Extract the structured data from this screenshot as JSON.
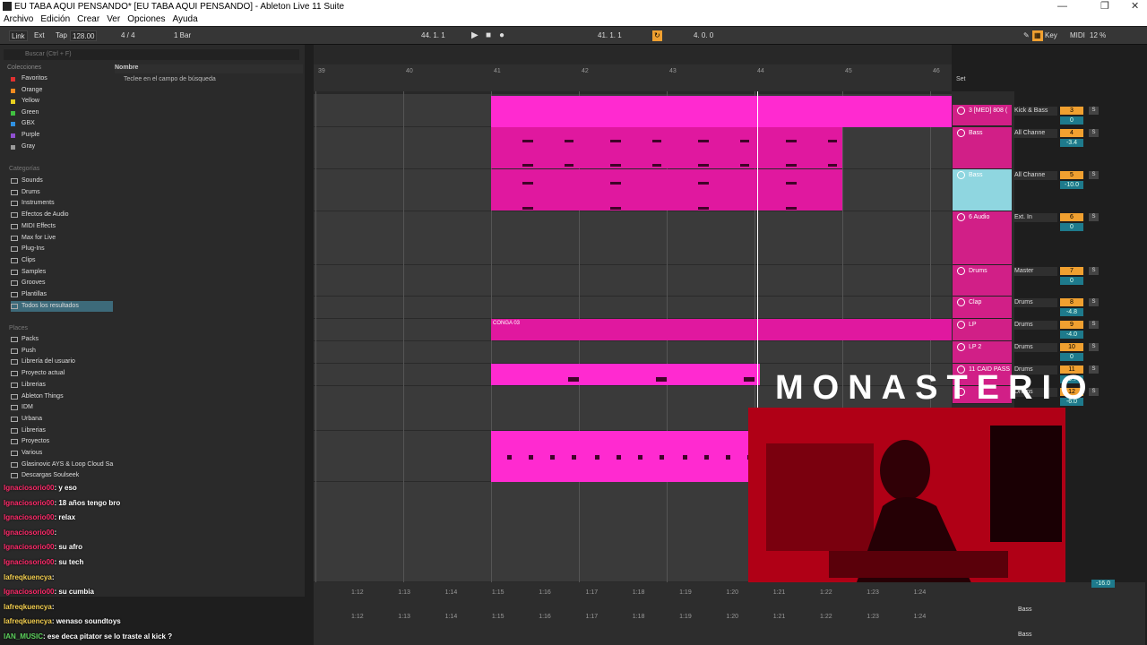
{
  "window": {
    "title": "EU TABA AQUI PENSANDO*  [EU TABA AQUI PENSANDO] - Ableton Live 11 Suite"
  },
  "menu": [
    "Archivo",
    "Edición",
    "Crear",
    "Ver",
    "Opciones",
    "Ayuda"
  ],
  "control": {
    "link": "Link",
    "ext": "Ext",
    "tap": "Tap",
    "tempo": "128.00",
    "meter": "4 / 4",
    "quant": "1 Bar",
    "pos": "44.   1.   1",
    "loop_start": "41.   1.   1",
    "loop_len": "4.   0.   0",
    "key": "Key",
    "midi": "MIDI",
    "cpu": "12 %"
  },
  "browser": {
    "search_placeholder": "Buscar (Ctrl + F)",
    "collections_label": "Colecciones",
    "name_header": "Nombre",
    "hint": "Teclee en el campo de búsqueda",
    "collections": [
      {
        "label": "Favoritos",
        "color": "#e03030"
      },
      {
        "label": "Orange",
        "color": "#f08a20"
      },
      {
        "label": "Yellow",
        "color": "#e8d020"
      },
      {
        "label": "Green",
        "color": "#40c040"
      },
      {
        "label": "GBX",
        "color": "#3090e0"
      },
      {
        "label": "Purple",
        "color": "#9050d0"
      },
      {
        "label": "Gray",
        "color": "#999999"
      }
    ],
    "categories_label": "Categorías",
    "categories": [
      "Sounds",
      "Drums",
      "Instruments",
      "Efectos de Audio",
      "MIDI Effects",
      "Max for Live",
      "Plug-Ins",
      "Clips",
      "Samples",
      "Grooves",
      "Plantillas",
      "Todos los resultados"
    ],
    "places_label": "Places",
    "places": [
      "Packs",
      "Push",
      "Librería del usuario",
      "Proyecto actual",
      "Librerias",
      "Ableton Things",
      "IDM",
      "Urbana",
      "Librerias",
      "Proyectos",
      "Various",
      "Glasinovic AYS & Loop Cloud Sa",
      "Descargas Soulseek"
    ]
  },
  "ruler": [
    "39",
    "40",
    "41",
    "42",
    "43",
    "44",
    "45",
    "46"
  ],
  "set_label": "Set",
  "clip_label": "CONGA 03",
  "tracks": [
    {
      "name": "3 [MED] 808 (",
      "io": "Kick & Bass",
      "num": "3",
      "vol": "0",
      "color": "#d11f87"
    },
    {
      "name": "Bass",
      "io": "All Channe",
      "num": "4",
      "vol": "-3.4",
      "color": "#d11f87"
    },
    {
      "name": "Bass",
      "io": "All Channe",
      "num": "5",
      "vol": "-10.0",
      "color": "#8fd6e0"
    },
    {
      "name": "6 Audio",
      "io": "Ext. In",
      "num": "6",
      "vol": "0",
      "color": "#d11f87"
    },
    {
      "name": "Drums",
      "io": "Master",
      "num": "7",
      "vol": "0",
      "color": "#d11f87"
    },
    {
      "name": "Clap",
      "io": "Drums",
      "num": "8",
      "vol": "-4.8",
      "color": "#d11f87"
    },
    {
      "name": "LP",
      "io": "Drums",
      "num": "9",
      "vol": "-4.0",
      "color": "#d11f87"
    },
    {
      "name": "LP 2",
      "io": "Drums",
      "num": "10",
      "vol": "0",
      "color": "#d11f87"
    },
    {
      "name": "11 CAID PASS",
      "io": "Drums",
      "num": "11",
      "vol": "-9.7",
      "color": "#d11f87"
    },
    {
      "name": "",
      "io": "Drums",
      "num": "12",
      "vol": "-6.0",
      "color": "#d11f87"
    }
  ],
  "overlay": {
    "logo": "MONASTERIO"
  },
  "chat": [
    {
      "user": "Ignaciosorio00",
      "msg": ": y eso",
      "cls": "u1"
    },
    {
      "user": "Ignaciosorio00",
      "msg": ": 18 años tengo bro",
      "cls": "u1"
    },
    {
      "user": "Ignaciosorio00",
      "msg": ": relax",
      "cls": "u1"
    },
    {
      "user": "Ignaciosorio00",
      "msg": ":",
      "cls": "u1"
    },
    {
      "user": "Ignaciosorio00",
      "msg": ": su afro",
      "cls": "u1"
    },
    {
      "user": "Ignaciosorio00",
      "msg": ": su tech",
      "cls": "u1"
    },
    {
      "user": "lafreqkuencya",
      "msg": ":",
      "cls": "u2"
    },
    {
      "user": "Ignaciosorio00",
      "msg": ": su cumbia",
      "cls": "u1"
    },
    {
      "user": "lafreqkuencya",
      "msg": ":",
      "cls": "u2"
    },
    {
      "user": "lafreqkuencya",
      "msg": ": wenaso soundtoys",
      "cls": "u2"
    },
    {
      "user": "IAN_MUSIC",
      "msg": ": ese deca pitator se lo traste al kick ?",
      "cls": "u3"
    }
  ],
  "bottom": {
    "times": [
      "1:12",
      "1:13",
      "1:14",
      "1:15",
      "1:16",
      "1:17",
      "1:18",
      "1:19",
      "1:20",
      "1:21",
      "1:22",
      "1:23",
      "1:24"
    ],
    "track": "Bass",
    "vol": "-16.0"
  }
}
